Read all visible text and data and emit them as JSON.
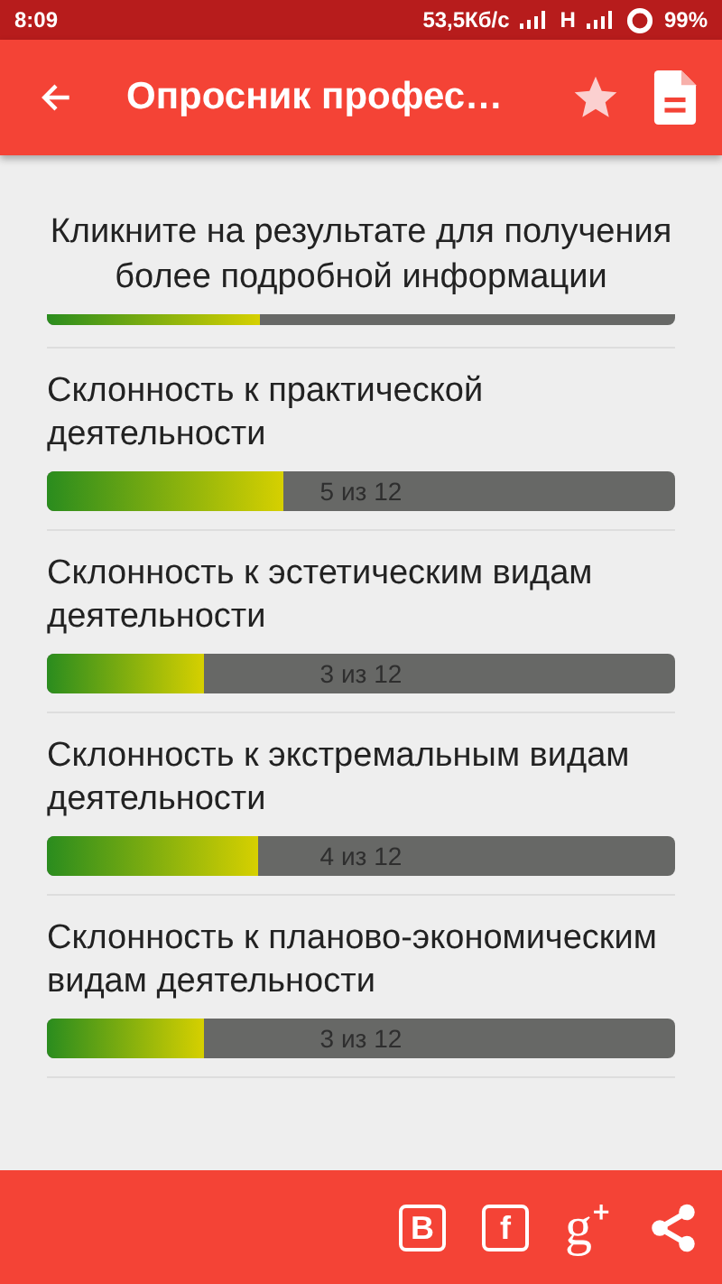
{
  "status_bar": {
    "time": "8:09",
    "speed": "53,5Кб/с",
    "network": "H",
    "battery": "99%"
  },
  "toolbar": {
    "title": "Опросник профес…"
  },
  "intro": "Кликните на результате для получения более подробной информации",
  "partial_bar": {
    "level": 0.34
  },
  "results": [
    {
      "title": "Склонность к практической деятельности",
      "level": 0.375,
      "score": "5 из 12"
    },
    {
      "title": "Склонность к эстетическим видам деятельности",
      "level": 0.25,
      "score": "3 из 12"
    },
    {
      "title": "Склонность к экстремальным видам деятельности",
      "level": 0.335,
      "score": "4 из 12"
    },
    {
      "title": "Склонность к планово-экономическим видам деятельности",
      "level": 0.25,
      "score": "3 из 12"
    }
  ],
  "share_buttons": [
    {
      "kind": "boxed",
      "glyph": "B"
    },
    {
      "kind": "boxed",
      "glyph": "f"
    },
    {
      "kind": "plain",
      "glyph": "g⁺"
    },
    {
      "kind": "share"
    }
  ]
}
